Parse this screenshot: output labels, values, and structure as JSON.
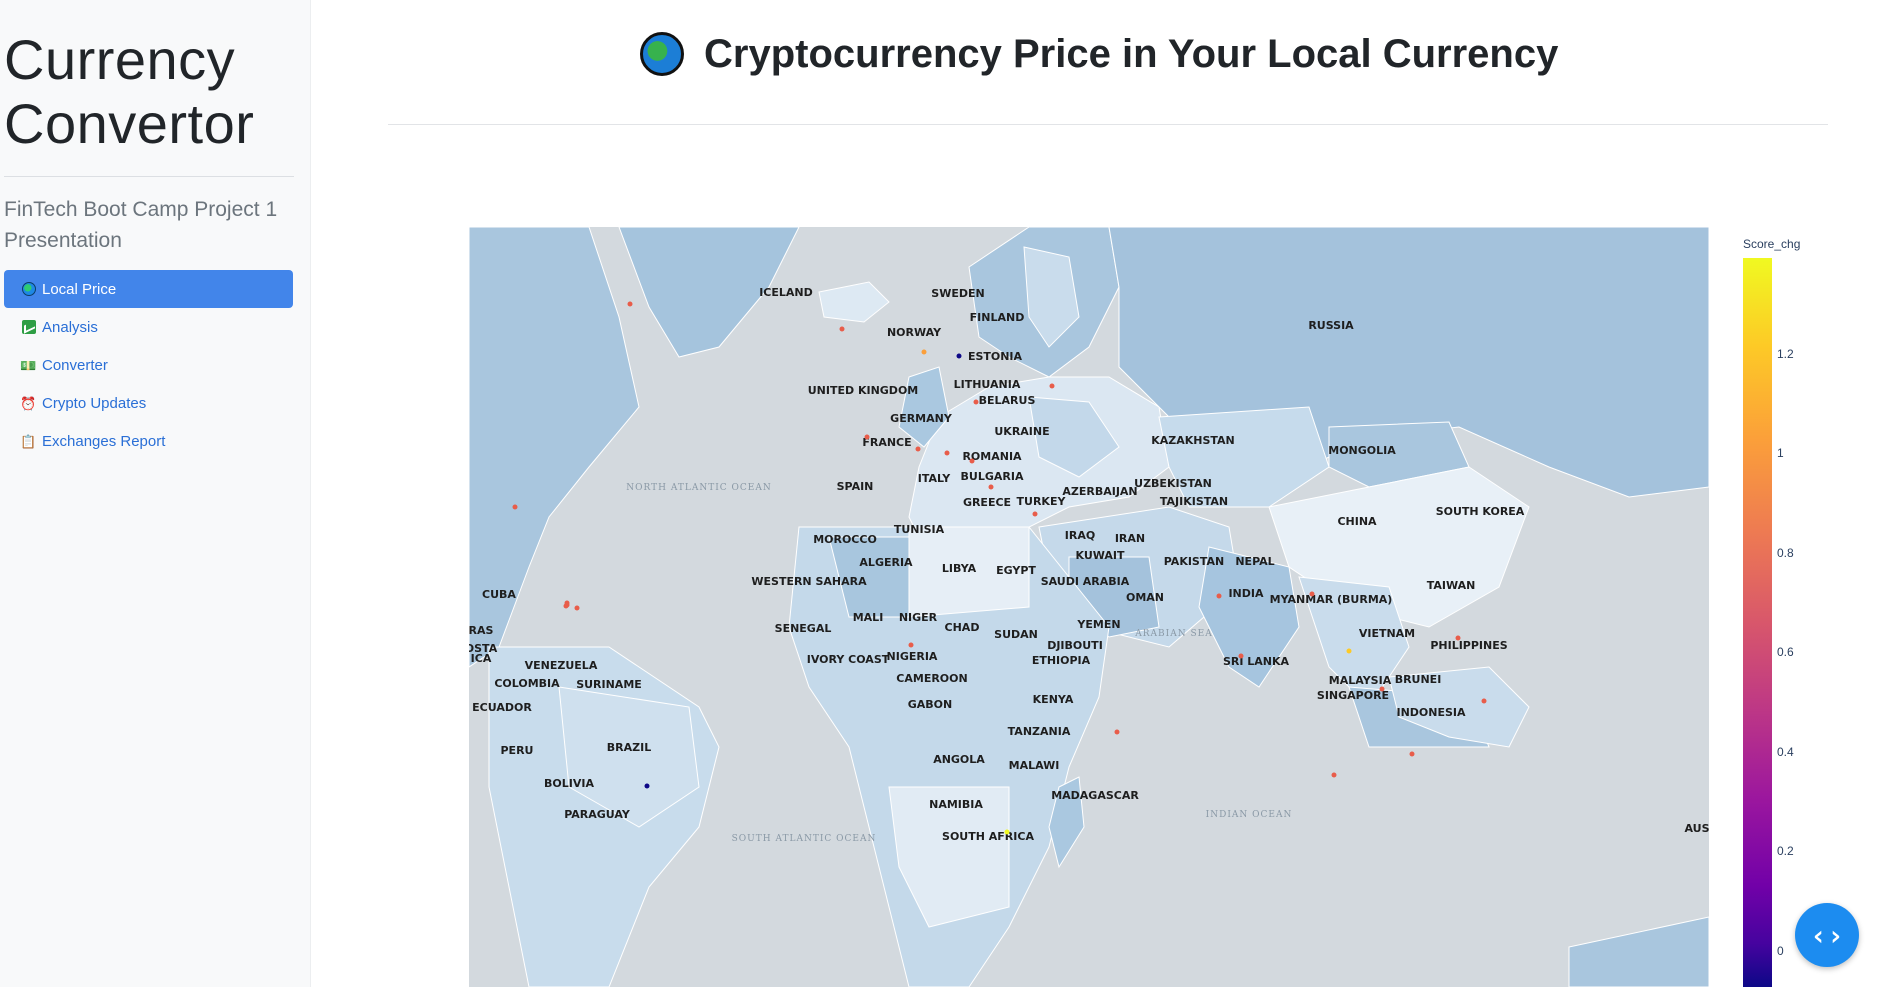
{
  "sidebar": {
    "app_title_line1": "Currency",
    "app_title_line2": "Convertor",
    "subtitle": "FinTech Boot Camp Project 1 Presentation",
    "nav": [
      {
        "label": "Local Price",
        "icon": "globe-icon",
        "active": true
      },
      {
        "label": "Analysis",
        "icon": "chart-increasing-icon",
        "active": false
      },
      {
        "label": "Converter",
        "icon": "money-stack-icon",
        "active": false
      },
      {
        "label": "Crypto Updates",
        "icon": "alarm-clock-icon",
        "active": false
      },
      {
        "label": "Exchanges Report",
        "icon": "clipboard-icon",
        "active": false
      }
    ]
  },
  "main": {
    "title": "Cryptocurrency Price in Your Local Currency",
    "title_icon": "globe-icon"
  },
  "map": {
    "countries": [
      "ICELAND",
      "SWEDEN",
      "FINLAND",
      "NORWAY",
      "ESTONIA",
      "RUSSIA",
      "UNITED KINGDOM",
      "LITHUANIA",
      "BELARUS",
      "GERMANY",
      "UKRAINE",
      "FRANCE",
      "ROMANIA",
      "KAZAKHSTAN",
      "MONGOLIA",
      "ITALY",
      "BULGARIA",
      "SPAIN",
      "UZBEKISTAN",
      "AZERBAIJAN",
      "TAJIKISTAN",
      "GREECE",
      "TURKEY",
      "SOUTH KOREA",
      "CHINA",
      "TUNISIA",
      "MOROCCO",
      "IRAQ",
      "IRAN",
      "ALGERIA",
      "LIBYA",
      "KUWAIT",
      "PAKISTAN",
      "NEPAL",
      "WESTERN SAHARA",
      "EGYPT",
      "SAUDI ARABIA",
      "OMAN",
      "INDIA",
      "TAIWAN",
      "CUBA",
      "MYANMAR (BURMA)",
      "SENEGAL",
      "MALI",
      "NIGER",
      "CHAD",
      "SUDAN",
      "YEMEN",
      "VIETNAM",
      "DJIBOUTI",
      "PHILIPPINES",
      "RAS",
      "OSTA",
      "ICA",
      "VENEZUELA",
      "IVORY COAST",
      "NIGERIA",
      "ETHIOPIA",
      "SRI LANKA",
      "COLOMBIA",
      "SURINAME",
      "CAMEROON",
      "MALAYSIA",
      "BRUNEI",
      "SINGAPORE",
      "ECUADOR",
      "GABON",
      "KENYA",
      "INDONESIA",
      "TANZANIA",
      "BRAZIL",
      "PERU",
      "ANGOLA",
      "MALAWI",
      "BOLIVIA",
      "MADAGASCAR",
      "NAMIBIA",
      "PARAGUAY",
      "SOUTH AFRICA",
      "AUS"
    ],
    "ocean_labels": [
      "NORTH ATLANTIC OCEAN",
      "ARABIAN SEA",
      "INDIAN OCEAN",
      "SOUTH ATLANTIC OCEAN"
    ],
    "colorbar": {
      "title": "Score_chg",
      "ticks": [
        "1.2",
        "1",
        "0.8",
        "0.6",
        "0.4",
        "0.2",
        "0"
      ],
      "colors": [
        "#f0f921",
        "#fdca26",
        "#fb9f3a",
        "#ed7953",
        "#d8576b",
        "#bd3786",
        "#9c179e",
        "#7201a8",
        "#46039f",
        "#0d0887"
      ]
    }
  },
  "colors": {
    "sidebar_bg": "#f8f9fa",
    "active_nav": "#4285ea",
    "link": "#2a6fd6",
    "ocean": "#d3d9de",
    "land": "#a9c6de",
    "code_button": "#1c8cf0"
  },
  "code_button": {
    "label": "‹ ›",
    "icon": "code-brackets-icon"
  }
}
